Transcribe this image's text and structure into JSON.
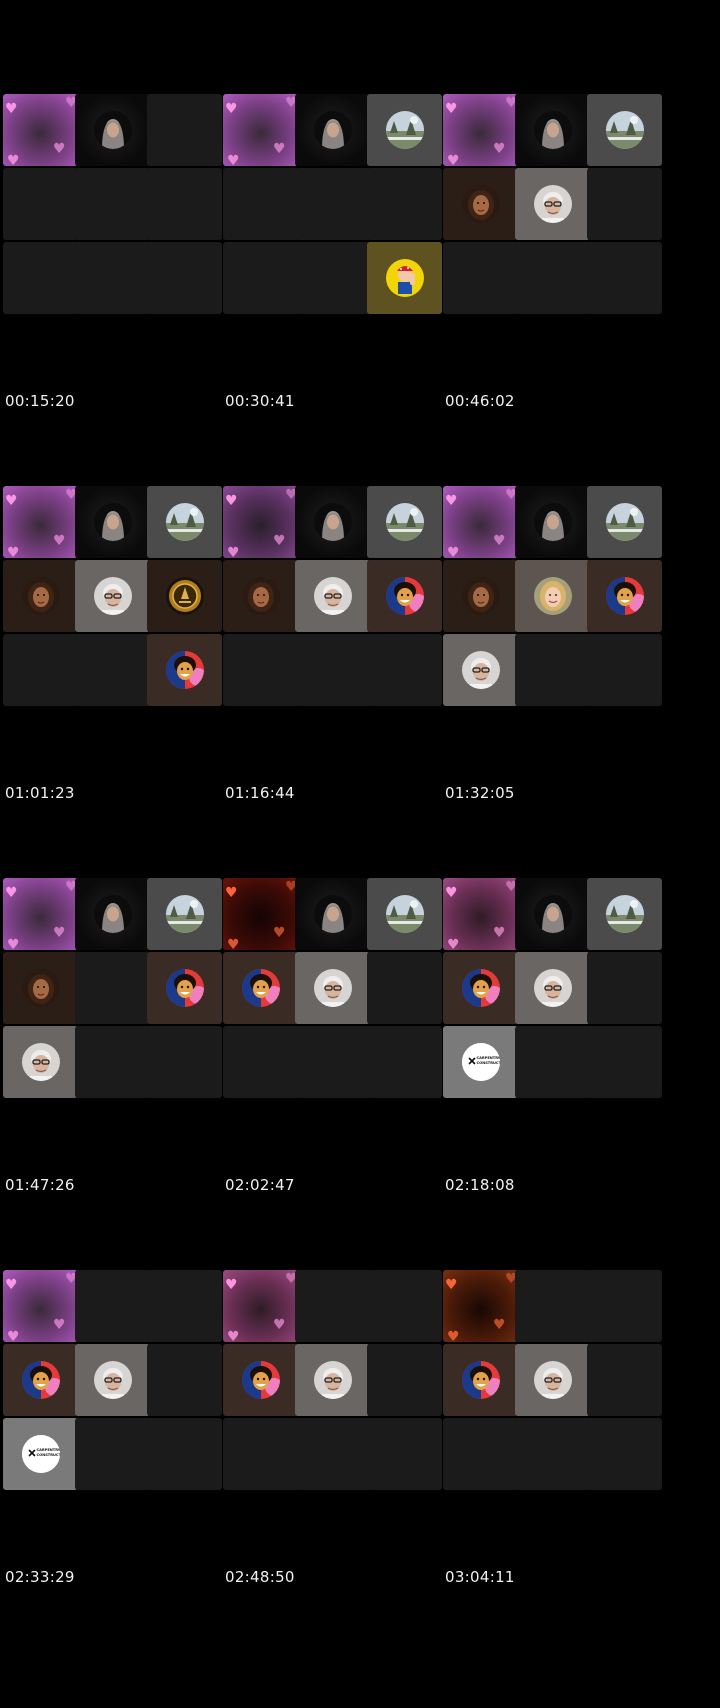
{
  "panels": [
    {
      "timestamp": "00:15:20",
      "tiles": [
        "pink",
        "hijab",
        "dark",
        "dark",
        "dark",
        "dark",
        "dark",
        "dark",
        "dark"
      ]
    },
    {
      "timestamp": "00:30:41",
      "tiles": [
        "pink",
        "hijab",
        "landscape",
        "dark",
        "dark",
        "dark",
        "dark",
        "dark",
        "cartoon"
      ]
    },
    {
      "timestamp": "00:46:02",
      "tiles": [
        "pink",
        "hijab",
        "landscape",
        "woman",
        "elder",
        "dark",
        "dark",
        "dark",
        "dark"
      ]
    },
    {
      "timestamp": "01:01:23",
      "tiles": [
        "pink",
        "hijab",
        "landscape",
        "woman",
        "elder",
        "seal",
        "dark",
        "dark",
        "curly"
      ]
    },
    {
      "timestamp": "01:16:44",
      "tiles": [
        "pink-dim",
        "hijab",
        "landscape",
        "woman",
        "elder",
        "curly",
        "dark",
        "dark",
        "dark"
      ]
    },
    {
      "timestamp": "01:32:05",
      "tiles": [
        "pink",
        "hijab",
        "landscape",
        "woman",
        "blonde",
        "curly",
        "elder",
        "dark",
        "dark"
      ]
    },
    {
      "timestamp": "01:47:26",
      "tiles": [
        "pink",
        "hijab",
        "landscape",
        "woman",
        "dark",
        "curly",
        "elder",
        "dark",
        "dark"
      ]
    },
    {
      "timestamp": "02:02:47",
      "tiles": [
        "red",
        "hijab",
        "landscape",
        "curly",
        "elder",
        "dark",
        "dark",
        "dark",
        "dark"
      ]
    },
    {
      "timestamp": "02:18:08",
      "tiles": [
        "pink-rose",
        "hijab",
        "landscape",
        "curly",
        "elder",
        "dark",
        "logo",
        "dark",
        "dark"
      ]
    },
    {
      "timestamp": "02:33:29",
      "tiles": [
        "pink",
        "dark",
        "dark",
        "curly",
        "elder",
        "dark",
        "logo",
        "dark",
        "dark"
      ]
    },
    {
      "timestamp": "02:48:50",
      "tiles": [
        "pink-rose",
        "dark",
        "dark",
        "curly",
        "elder",
        "dark",
        "dark",
        "dark",
        "dark"
      ]
    },
    {
      "timestamp": "03:04:11",
      "tiles": [
        "orange",
        "dark",
        "dark",
        "curly",
        "elder",
        "dark",
        "dark",
        "dark",
        "dark"
      ]
    }
  ],
  "logo_text": [
    "CARPENTRY &",
    "CONSTRUCTION"
  ],
  "colors": {
    "background": "#000000",
    "tile": "#1b1b1b",
    "timestamp": "#f2f2f2",
    "heart": "#ff9be8"
  }
}
